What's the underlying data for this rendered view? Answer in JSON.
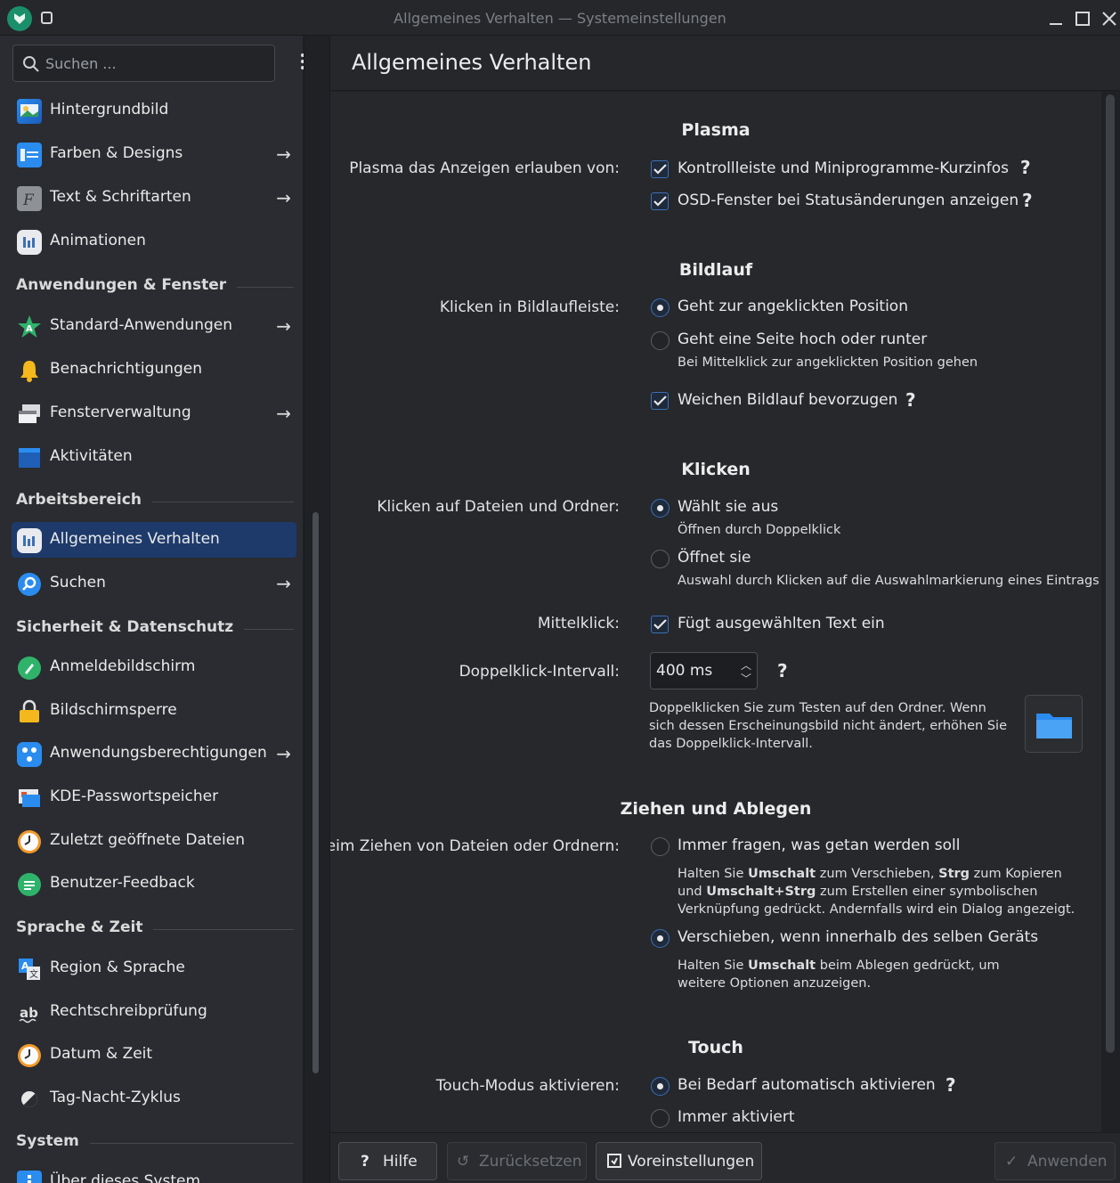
{
  "window": {
    "title": "Allgemeines Verhalten — Systemeinstellungen"
  },
  "sidebar": {
    "search_placeholder": "Suchen ...",
    "items": [
      {
        "label": "Hintergrundbild",
        "icon": "wallpaper-icon",
        "arrow": false
      },
      {
        "label": "Farben & Designs",
        "icon": "colors-icon",
        "arrow": true
      },
      {
        "label": "Text & Schriftarten",
        "icon": "fonts-icon",
        "arrow": true
      },
      {
        "label": "Animationen",
        "icon": "animations-icon",
        "arrow": false
      },
      {
        "label": "Standard-Anwendungen",
        "icon": "default-apps-icon",
        "arrow": true
      },
      {
        "label": "Benachrichtigungen",
        "icon": "bell-icon",
        "arrow": false
      },
      {
        "label": "Fensterverwaltung",
        "icon": "window-management-icon",
        "arrow": true
      },
      {
        "label": "Aktivitäten",
        "icon": "activities-icon",
        "arrow": false
      },
      {
        "label": "Allgemeines Verhalten",
        "icon": "general-behavior-icon",
        "arrow": false,
        "active": true
      },
      {
        "label": "Suchen",
        "icon": "search-settings-icon",
        "arrow": true
      },
      {
        "label": "Anmeldebildschirm",
        "icon": "login-screen-icon",
        "arrow": false
      },
      {
        "label": "Bildschirmsperre",
        "icon": "lock-icon",
        "arrow": false
      },
      {
        "label": "Anwendungsberechtigungen",
        "icon": "app-permissions-icon",
        "arrow": true
      },
      {
        "label": "KDE-Passwortspeicher",
        "icon": "wallet-icon",
        "arrow": false
      },
      {
        "label": "Zuletzt geöffnete Dateien",
        "icon": "recent-files-icon",
        "arrow": false
      },
      {
        "label": "Benutzer-Feedback",
        "icon": "feedback-icon",
        "arrow": false
      },
      {
        "label": "Region & Sprache",
        "icon": "region-language-icon",
        "arrow": false
      },
      {
        "label": "Rechtschreibprüfung",
        "icon": "spellcheck-icon",
        "arrow": false
      },
      {
        "label": "Datum & Zeit",
        "icon": "clock-icon",
        "arrow": false
      },
      {
        "label": "Tag-Nacht-Zyklus",
        "icon": "day-night-icon",
        "arrow": false
      },
      {
        "label": "Über dieses System",
        "icon": "info-icon",
        "arrow": false
      }
    ],
    "headers": [
      "Anwendungen & Fenster",
      "Arbeitsbereich",
      "Sicherheit & Datenschutz",
      "Sprache & Zeit",
      "System"
    ]
  },
  "page": {
    "title": "Allgemeines Verhalten"
  },
  "plasma": {
    "title": "Plasma",
    "label": "Plasma das Anzeigen erlauben von:",
    "opt1": "Kontrollleiste und Miniprogramme-Kurzinfos",
    "opt2": "OSD-Fenster bei Statusänderungen anzeigen"
  },
  "scrolling": {
    "title": "Bildlauf",
    "label": "Klicken in Bildlaufleiste:",
    "opt1": "Geht zur angeklickten Position",
    "opt2": "Geht eine Seite hoch oder runter",
    "opt2_hint": "Bei Mittelklick zur angeklickten Position gehen",
    "smooth": "Weichen Bildlauf bevorzugen"
  },
  "clicking": {
    "title": "Klicken",
    "label": "Klicken auf Dateien und Ordner:",
    "opt1": "Wählt sie aus",
    "opt1_hint": "Öffnen durch Doppelklick",
    "opt2": "Öffnet sie",
    "opt2_hint": "Auswahl durch Klicken auf die Auswahlmarkierung eines Eintrags",
    "middle_label": "Mittelklick:",
    "middle_opt": "Fügt ausgewählten Text ein",
    "dbl_label": "Doppelklick-Intervall:",
    "dbl_value": "400 ms",
    "dbl_hint": "Doppelklicken Sie zum Testen auf den Ordner. Wenn sich dessen Erscheinungsbild nicht ändert, erhöhen Sie das Doppelklick-Intervall."
  },
  "dnd": {
    "title": "Ziehen und Ablegen",
    "label": "Beim Ziehen von Dateien oder Ordnern:",
    "opt1": "Immer fragen, was getan werden soll",
    "opt1_hint_a": "Halten Sie ",
    "opt1_hint_b": "Umschalt",
    "opt1_hint_c": " zum Verschieben, ",
    "opt1_hint_d": "Strg",
    "opt1_hint_e": " zum Kopieren und ",
    "opt1_hint_f": "Umschalt+Strg",
    "opt1_hint_g": " zum Erstellen einer symbolischen Verknüpfung gedrückt. Andernfalls wird ein Dialog angezeigt.",
    "opt2": "Verschieben, wenn innerhalb des selben Geräts",
    "opt2_hint_a": "Halten Sie ",
    "opt2_hint_b": "Umschalt",
    "opt2_hint_c": " beim Ablegen gedrückt, um weitere Optionen anzuzeigen."
  },
  "touch": {
    "title": "Touch",
    "label": "Touch-Modus aktivieren:",
    "opt1": "Bei Bedarf automatisch aktivieren",
    "opt2": "Immer aktiviert"
  },
  "footer": {
    "help": "Hilfe",
    "reset": "Zurücksetzen",
    "defaults": "Voreinstellungen",
    "apply": "Anwenden"
  },
  "colors": {
    "accent": "#3d6fb6",
    "active_bg": "#1d3a6b"
  }
}
